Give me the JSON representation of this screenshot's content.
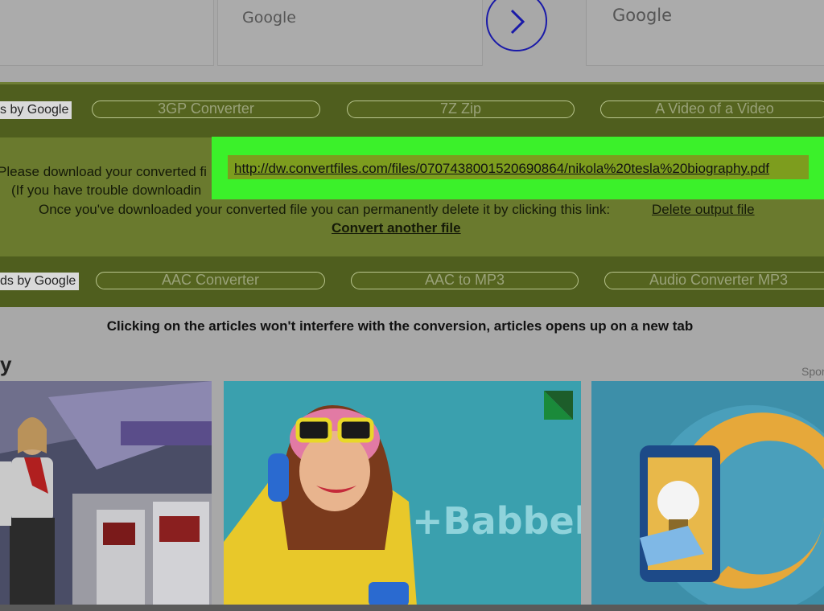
{
  "top_ads": {
    "card1_label": "Google",
    "card2_label": "Google"
  },
  "ads_strip_top": {
    "adsby": "s by Google",
    "links": [
      "3GP Converter",
      "7Z Zip",
      "A Video of a Video"
    ]
  },
  "download": {
    "line1_prefix": "Please download your converted fi",
    "link_url": "http://dw.convertfiles.com/files/0707438001520690864/nikola%20tesla%20biography.pdf",
    "line2_prefix": "(If you have trouble downloadin",
    "line3_text": "Once you've downloaded your converted file you can permanently delete it by clicking this link:",
    "delete_link": "Delete output file",
    "convert_another": "Convert another file"
  },
  "ads_strip_bottom": {
    "adsby": "ds by Google",
    "links": [
      "AAC Converter",
      "AAC to MP3",
      "Audio Converter MP3"
    ]
  },
  "notice": "Clicking on the articles won't interfere with the conversion, articles opens up on a new tab",
  "section_letter": "y",
  "sponsored_label": "Spor",
  "tiles": {
    "babbel_brand": "+Babbel"
  },
  "colors": {
    "highlight": "#3bf12a",
    "green_panel": "#5e6d28",
    "next_arrow": "#1a1aa8"
  }
}
